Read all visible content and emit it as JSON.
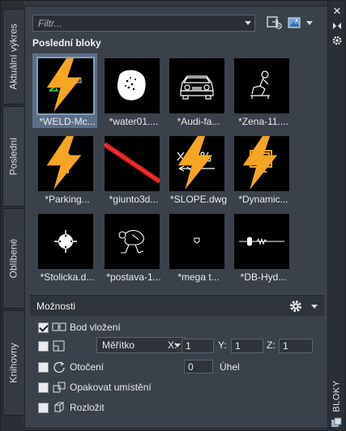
{
  "tabs": [
    {
      "label": "Aktuální výkres"
    },
    {
      "label": "Poslední"
    },
    {
      "label": "Oblíbené"
    },
    {
      "label": "Knihovny"
    }
  ],
  "right_strip": {
    "title": "BLOKY"
  },
  "toolbar": {
    "filter_placeholder": "Filtr..."
  },
  "section": {
    "title": "Poslední bloky"
  },
  "blocks": [
    {
      "label": "*WELD-Mc...",
      "icon": "weld-icon",
      "dynamic": true,
      "selected": true
    },
    {
      "label": "*water01....",
      "icon": "water-icon",
      "dynamic": false
    },
    {
      "label": "*Audi-fa...",
      "icon": "car-icon",
      "dynamic": false
    },
    {
      "label": "*Zena-11....",
      "icon": "woman-seated-icon",
      "dynamic": false
    },
    {
      "label": "*Parking...",
      "icon": "arrow-up-icon",
      "dynamic": true
    },
    {
      "label": "*giunto3d...",
      "icon": "joint-icon",
      "dynamic": false
    },
    {
      "label": "*SLOPE.dwg",
      "icon": "slope-icon",
      "dynamic": true
    },
    {
      "label": "*Dynamic...",
      "icon": "monitor-icon",
      "dynamic": true
    },
    {
      "label": "*Stolicka.d...",
      "icon": "stool-icon",
      "dynamic": false
    },
    {
      "label": "*postava-1...",
      "icon": "figure-icon",
      "dynamic": false
    },
    {
      "label": "*mega t...",
      "icon": "point-icon",
      "dynamic": false
    },
    {
      "label": "*DB-Hyd...",
      "icon": "hydrant-icon",
      "dynamic": false
    }
  ],
  "options": {
    "title": "Možnosti",
    "insertion_point": {
      "label": "Bod vložení",
      "checked": true
    },
    "scale": {
      "mode": "Měřítko",
      "checked": false,
      "x_label": "X:",
      "x": "1",
      "y_label": "Y:",
      "y": "1",
      "z_label": "Z:",
      "z": "1"
    },
    "rotation": {
      "label": "Otočení",
      "checked": false,
      "value": "0",
      "unit_label": "Úhel"
    },
    "repeat": {
      "label": "Opakovat umístění",
      "checked": false
    },
    "explode": {
      "label": "Rozložit",
      "checked": false
    }
  },
  "colors": {
    "accent": "#f5a623",
    "selection": "#5c6f88",
    "panel": "#3b414b"
  }
}
